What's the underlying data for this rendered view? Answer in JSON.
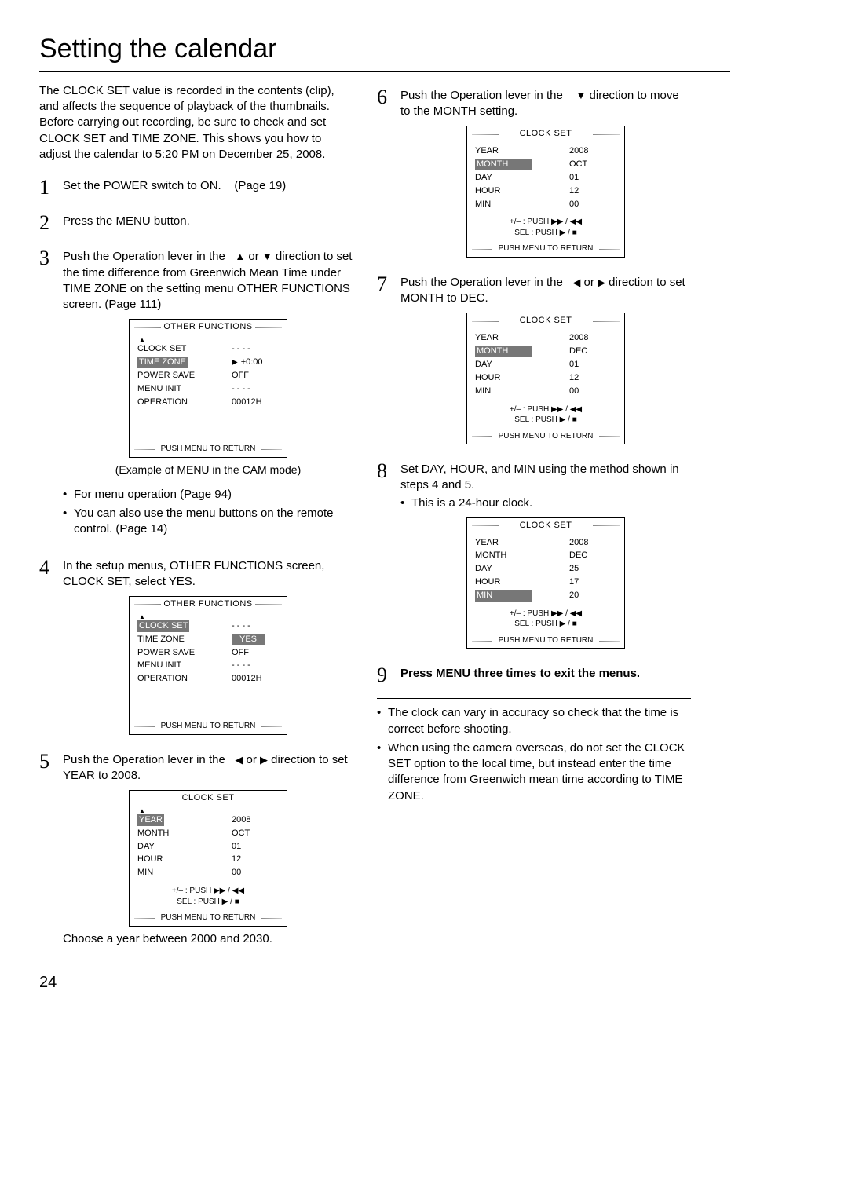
{
  "page_title": "Setting the calendar",
  "intro": "The CLOCK SET value is recorded in the contents (clip), and affects the sequence of playback of the thumbnails. Before carrying out recording, be sure to check and set CLOCK SET and TIME ZONE. This shows you how to adjust the calendar to 5:20 PM on December 25, 2008.",
  "step1": {
    "text_a": "Set the POWER switch to ON.",
    "text_b": "(Page 19)"
  },
  "step2": "Press the MENU button.",
  "step3": {
    "text_a": "Push the Operation lever in the",
    "text_b": "or",
    "text_c": "direction to set the time difference from Greenwich Mean Time under TIME ZONE on the setting menu OTHER FUNCTIONS screen. (Page  111)",
    "menu_title": "OTHER FUNCTIONS",
    "rows": [
      {
        "l": "CLOCK SET",
        "v": "- - - -"
      },
      {
        "l": "TIME ZONE",
        "v": "+0:00",
        "hl": true,
        "cursor": true
      },
      {
        "l": "POWER SAVE",
        "v": "OFF"
      },
      {
        "l": "MENU INIT",
        "v": "- - - -"
      },
      {
        "l": "OPERATION",
        "v": "00012H"
      }
    ],
    "footer": "PUSH  MENU TO RETURN",
    "caption": "(Example of MENU in the CAM mode)",
    "bullets": [
      "For menu operation (Page 94)",
      "You can also use the menu buttons on the remote control. (Page 14)"
    ]
  },
  "step4": {
    "text": "In the setup menus, OTHER FUNCTIONS screen, CLOCK SET, select YES.",
    "menu_title": "OTHER FUNCTIONS",
    "rows": [
      {
        "l": "CLOCK SET",
        "v": "- - - -",
        "hl": true
      },
      {
        "l": "TIME ZONE",
        "v": "YES",
        "vhl": true
      },
      {
        "l": "POWER SAVE",
        "v": "OFF"
      },
      {
        "l": "MENU INIT",
        "v": "- - - -"
      },
      {
        "l": "OPERATION",
        "v": "00012H"
      }
    ],
    "footer": "PUSH  MENU TO RETURN"
  },
  "step5": {
    "text_a": "Push the Operation lever in the",
    "text_b": "or",
    "text_c": "direction to set YEAR to 2008.",
    "menu_title": "CLOCK SET",
    "rows": [
      {
        "l": "YEAR",
        "v": "2008",
        "hl": true
      },
      {
        "l": "MONTH",
        "v": "OCT"
      },
      {
        "l": "DAY",
        "v": "01"
      },
      {
        "l": "HOUR",
        "v": "12"
      },
      {
        "l": "MIN",
        "v": "00"
      }
    ],
    "hints_a": "+/– : PUSH ▶▶ / ◀◀",
    "hints_b": "SEL : PUSH ▶ / ■",
    "footer": "PUSH  MENU TO RETURN",
    "note": "Choose a year between 2000 and 2030."
  },
  "step6": {
    "text_a": "Push the Operation lever in the",
    "text_b": "direction to move to the MONTH setting.",
    "menu_title": "CLOCK SET",
    "rows": [
      {
        "l": "YEAR",
        "v": "2008"
      },
      {
        "l": "MONTH",
        "v": "OCT",
        "hl": true
      },
      {
        "l": "DAY",
        "v": "01"
      },
      {
        "l": "HOUR",
        "v": "12"
      },
      {
        "l": "MIN",
        "v": "00"
      }
    ],
    "hints_a": "+/– : PUSH ▶▶ / ◀◀",
    "hints_b": "SEL : PUSH ▶ / ■",
    "footer": "PUSH  MENU TO RETURN"
  },
  "step7": {
    "text_a": "Push the Operation lever in the",
    "text_b": "or",
    "text_c": "direction to set MONTH to DEC.",
    "menu_title": "CLOCK SET",
    "rows": [
      {
        "l": "YEAR",
        "v": "2008"
      },
      {
        "l": "MONTH",
        "v": "DEC",
        "hl": true
      },
      {
        "l": "DAY",
        "v": "01"
      },
      {
        "l": "HOUR",
        "v": "12"
      },
      {
        "l": "MIN",
        "v": "00"
      }
    ],
    "hints_a": "+/– : PUSH ▶▶ / ◀◀",
    "hints_b": "SEL : PUSH ▶ / ■",
    "footer": "PUSH  MENU TO RETURN"
  },
  "step8": {
    "text": "Set DAY, HOUR, and MIN using the method shown in steps 4 and 5.",
    "sub": "This is a 24-hour clock.",
    "menu_title": "CLOCK SET",
    "rows": [
      {
        "l": "YEAR",
        "v": "2008"
      },
      {
        "l": "MONTH",
        "v": "DEC"
      },
      {
        "l": "DAY",
        "v": "25"
      },
      {
        "l": "HOUR",
        "v": "17"
      },
      {
        "l": "MIN",
        "v": "20",
        "hl": true
      }
    ],
    "hints_a": "+/– : PUSH ▶▶ / ◀◀",
    "hints_b": "SEL : PUSH ▶ / ■",
    "footer": "PUSH  MENU TO RETURN"
  },
  "step9": "Press MENU three times to exit the menus.",
  "end_bullets": [
    "The clock can vary in accuracy so check that the time is correct before shooting.",
    "When using the camera overseas, do not set the CLOCK SET option to the local time, but instead enter the time difference from Greenwich mean time according to TIME ZONE."
  ],
  "page_number": "24"
}
